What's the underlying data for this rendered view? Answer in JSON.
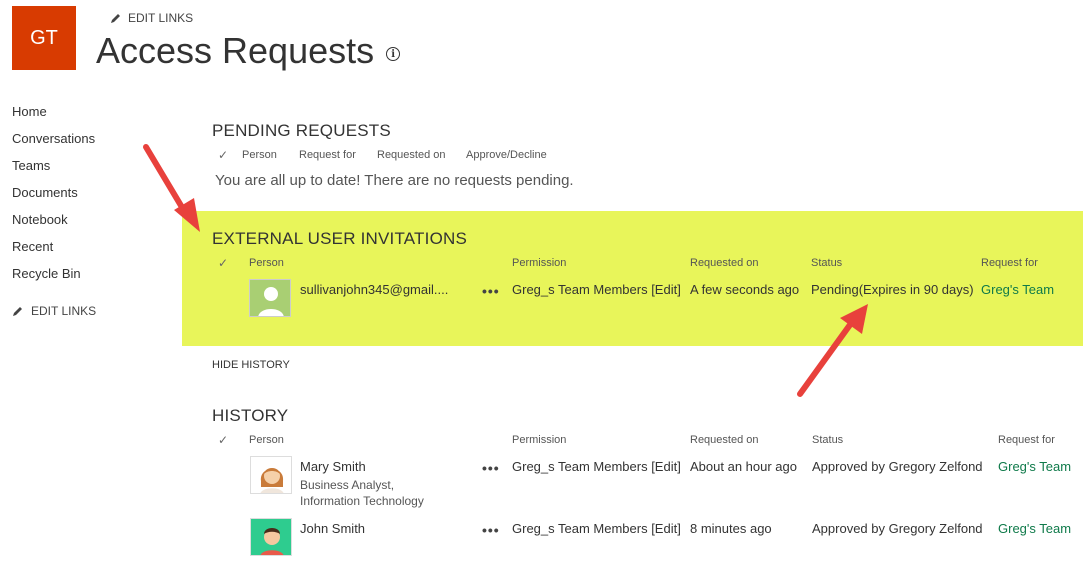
{
  "site": {
    "logo_text": "GT",
    "edit_links": "EDIT LINKS",
    "title": "Access Requests"
  },
  "nav": {
    "items": [
      "Home",
      "Conversations",
      "Teams",
      "Documents",
      "Notebook",
      "Recent",
      "Recycle Bin"
    ],
    "edit_links": "EDIT LINKS"
  },
  "pending": {
    "title": "PENDING REQUESTS",
    "headers": {
      "person": "Person",
      "request_for": "Request for",
      "requested_on": "Requested on",
      "approve": "Approve/Decline"
    },
    "empty_message": "You are all up to date! There are no requests pending."
  },
  "external": {
    "title": "EXTERNAL USER INVITATIONS",
    "headers": {
      "person": "Person",
      "permission": "Permission",
      "requested_on": "Requested on",
      "status": "Status",
      "request_for": "Request for"
    },
    "rows": [
      {
        "person": "sullivanjohn345@gmail....",
        "permission": "Greg_s Team Members [Edit]",
        "requested_on": "A few seconds ago",
        "status": "Pending(Expires in 90 days)",
        "request_for": "Greg's Team"
      }
    ]
  },
  "hide_history": "HIDE HISTORY",
  "history": {
    "title": "HISTORY",
    "headers": {
      "person": "Person",
      "permission": "Permission",
      "requested_on": "Requested on",
      "status": "Status",
      "request_for": "Request for"
    },
    "rows": [
      {
        "person": "Mary Smith",
        "subtitle_1": "Business Analyst,",
        "subtitle_2": "Information Technology",
        "permission": "Greg_s Team Members [Edit]",
        "requested_on": "About an hour ago",
        "status": "Approved by Gregory Zelfond",
        "request_for": "Greg's Team"
      },
      {
        "person": "John Smith",
        "permission": "Greg_s Team Members [Edit]",
        "requested_on": "8 minutes ago",
        "status": "Approved by Gregory Zelfond",
        "request_for": "Greg's Team"
      }
    ]
  },
  "glyphs": {
    "check": "✓",
    "dots": "•••",
    "info": "i"
  },
  "colors": {
    "logo": "#d83b01",
    "highlight": "#e8f55a",
    "arrow": "#e8413c",
    "link": "#0f7a4a"
  }
}
